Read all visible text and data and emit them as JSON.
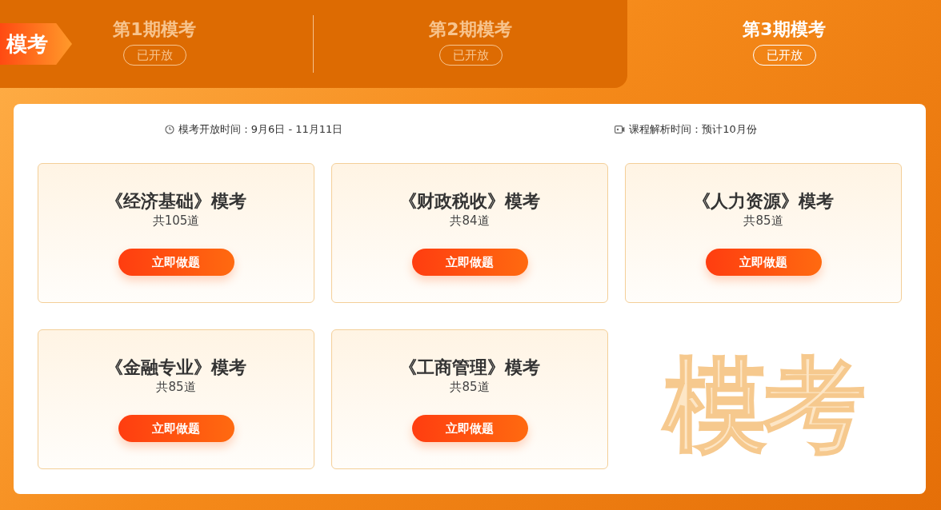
{
  "badge": "模考",
  "tabs": [
    {
      "label": "第1期模考",
      "status": "已开放",
      "selected": false
    },
    {
      "label": "第2期模考",
      "status": "已开放",
      "selected": false
    },
    {
      "label": "第3期模考",
      "status": "已开放",
      "selected": true
    }
  ],
  "info": [
    {
      "kind": "clock",
      "text": "模考开放时间：9月6日 - 11月11日"
    },
    {
      "kind": "video",
      "text": "课程解析时间：预计10月份"
    }
  ],
  "exams": [
    {
      "title": "《经济基础》模考",
      "count": "共105道",
      "button": "立即做题"
    },
    {
      "title": "《财政税收》模考",
      "count": "共84道",
      "button": "立即做题"
    },
    {
      "title": "《人力资源》模考",
      "count": "共85道",
      "button": "立即做题"
    },
    {
      "title": "《金融专业》模考",
      "count": "共85道",
      "button": "立即做题"
    },
    {
      "title": "《工商管理》模考",
      "count": "共85道",
      "button": "立即做题"
    }
  ],
  "decor_text": "模考"
}
